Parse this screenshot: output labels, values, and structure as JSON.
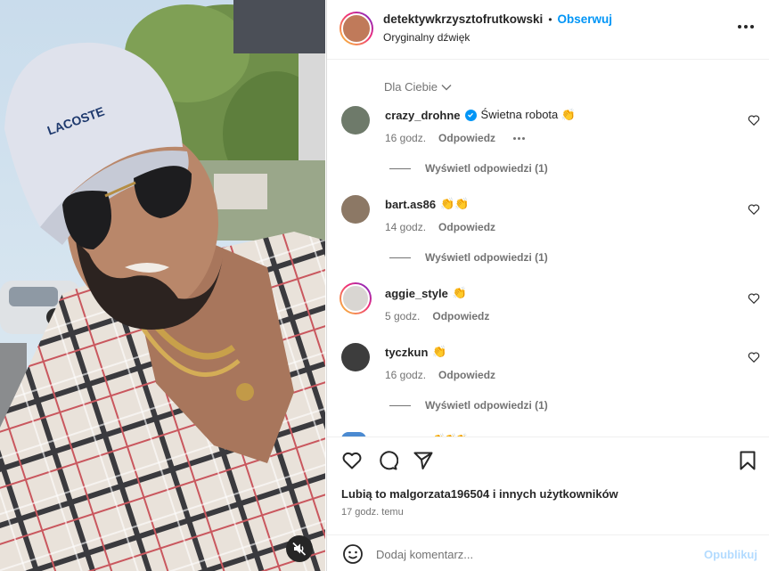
{
  "post": {
    "username": "detektywkrzysztofrutkowski",
    "separator": "•",
    "follow_label": "Obserwuj",
    "audio": "Oryginalny dźwięk",
    "more_icon": "more-horizontal-icon"
  },
  "comments_filter": {
    "label": "Dla Ciebie",
    "icon": "chevron-down-icon"
  },
  "comments": [
    {
      "user": "crazy_drohne",
      "verified": true,
      "text": "Świetna robota 👏",
      "time": "16 godz.",
      "reply": "Odpowiedz",
      "has_more": true,
      "replies": "Wyświetl odpowiedzi (1)"
    },
    {
      "user": "bart.as86",
      "verified": false,
      "text": "👏👏",
      "time": "14 godz.",
      "reply": "Odpowiedz",
      "has_more": false,
      "replies": "Wyświetl odpowiedzi (1)"
    },
    {
      "user": "aggie_style",
      "verified": false,
      "text": "👏",
      "time": "5 godz.",
      "reply": "Odpowiedz",
      "has_more": false,
      "replies": ""
    },
    {
      "user": "tyczkun",
      "verified": false,
      "text": "👏",
      "time": "16 godz.",
      "reply": "Odpowiedz",
      "has_more": false,
      "replies": "Wyświetl odpowiedzi (1)"
    }
  ],
  "partial_comment": {
    "text": "👏👏👏"
  },
  "actions": {
    "likes_prefix": "Lubią to",
    "likes_user": "malgorzata196504",
    "likes_suffix": "i innych użytkowników",
    "timestamp": "17 godz. temu"
  },
  "add_comment": {
    "placeholder": "Dodaj komentarz...",
    "publish_label": "Opublikuj"
  },
  "colors": {
    "accent": "#0095f6",
    "text": "#262626",
    "muted": "#737373",
    "publish_disabled": "#b3dbff"
  }
}
